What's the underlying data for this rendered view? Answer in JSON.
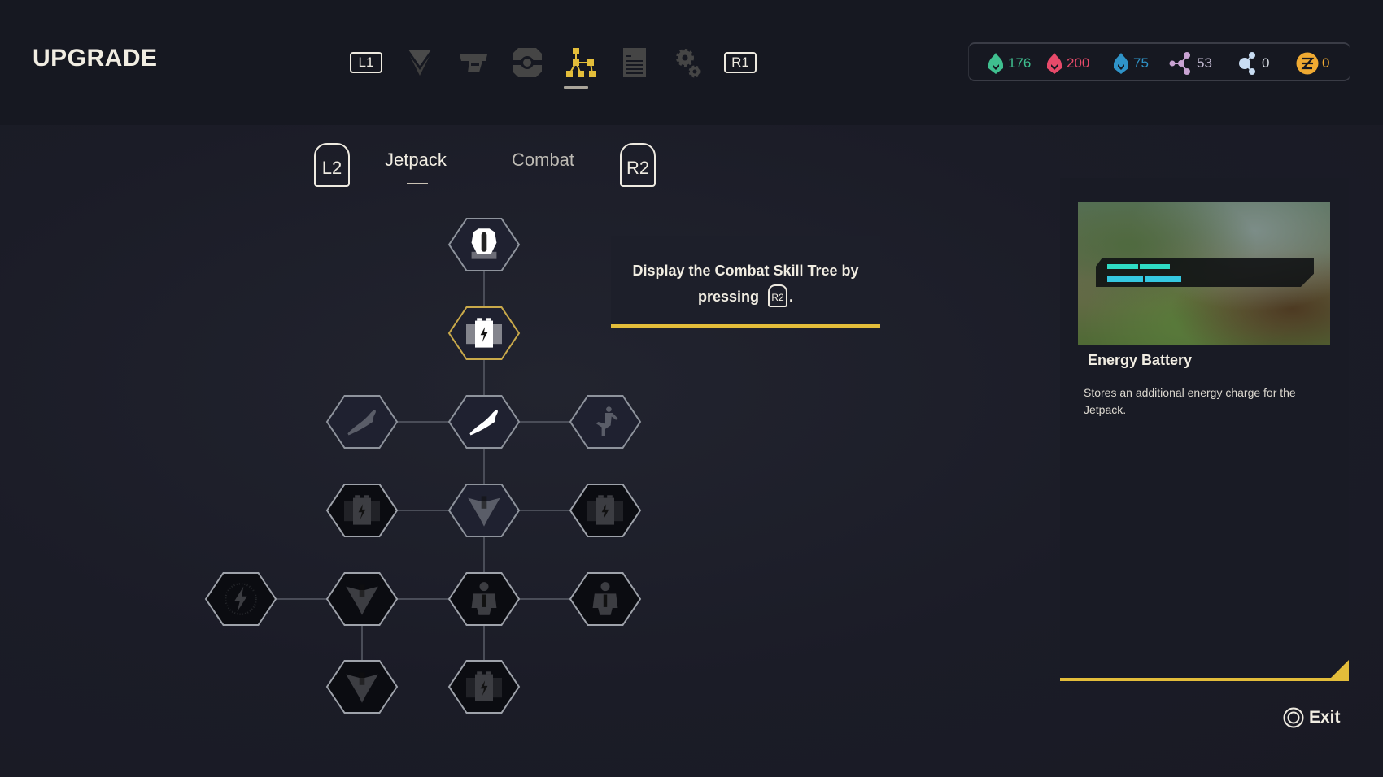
{
  "header": {
    "title": "UPGRADE",
    "nav": {
      "left_button": "L1",
      "right_button": "R1",
      "items": [
        {
          "icon": "chevron-emblem-icon",
          "active": false
        },
        {
          "icon": "weapon-icon",
          "active": false
        },
        {
          "icon": "gear-module-icon",
          "active": false
        },
        {
          "icon": "skill-tree-icon",
          "active": true
        },
        {
          "icon": "document-icon",
          "active": false
        },
        {
          "icon": "settings-gears-icon",
          "active": false
        }
      ]
    },
    "currencies": [
      {
        "icon": "green-flame-icon",
        "value": "176",
        "color": "#3fbf8f"
      },
      {
        "icon": "red-flame-icon",
        "value": "200",
        "color": "#e84a6a"
      },
      {
        "icon": "blue-flame-icon",
        "value": "75",
        "color": "#2f93c8"
      },
      {
        "icon": "purple-node-icon",
        "value": "53",
        "color": "#c9a3d3"
      },
      {
        "icon": "light-blue-node-icon",
        "value": "0",
        "color": "#c8dcf2"
      },
      {
        "icon": "z-coin-icon",
        "value": "0",
        "color": "#f0aa32"
      }
    ]
  },
  "tabs": {
    "left_trigger": "L2",
    "right_trigger": "R2",
    "items": [
      {
        "label": "Jetpack",
        "active": true
      },
      {
        "label": "Combat",
        "active": false
      }
    ]
  },
  "skill_tree": {
    "nodes": [
      {
        "id": "jetpack-core",
        "icon": "jetpack-icon",
        "state": "unlocked",
        "col": 2,
        "row": 0
      },
      {
        "id": "energy-battery",
        "icon": "battery-icon",
        "state": "selected",
        "col": 2,
        "row": 1
      },
      {
        "id": "glide",
        "icon": "glide-figure-icon",
        "state": "available",
        "col": 1,
        "row": 2
      },
      {
        "id": "flight",
        "icon": "flying-figure-icon",
        "state": "unlocked",
        "col": 2,
        "row": 2
      },
      {
        "id": "dash-kick",
        "icon": "kick-figure-icon",
        "state": "available",
        "col": 3,
        "row": 2
      },
      {
        "id": "battery-left",
        "icon": "battery-icon",
        "state": "locked",
        "col": 1,
        "row": 3
      },
      {
        "id": "wing-suit",
        "icon": "wingsuit-icon",
        "state": "available",
        "col": 2,
        "row": 3
      },
      {
        "id": "battery-right",
        "icon": "battery-icon",
        "state": "locked",
        "col": 3,
        "row": 3
      },
      {
        "id": "energy-burst",
        "icon": "lightning-icon",
        "state": "locked",
        "col": 0,
        "row": 4
      },
      {
        "id": "wing-suit-2",
        "icon": "wingsuit-icon",
        "state": "locked",
        "col": 1,
        "row": 4
      },
      {
        "id": "jetpack-armor",
        "icon": "jetpack-body-icon",
        "state": "locked",
        "col": 2,
        "row": 4
      },
      {
        "id": "jetpack-armor-2",
        "icon": "jetpack-body-icon",
        "state": "locked",
        "col": 3,
        "row": 4
      },
      {
        "id": "wing-suit-3",
        "icon": "wingsuit-icon",
        "state": "locked",
        "col": 1,
        "row": 5
      },
      {
        "id": "battery-bottom",
        "icon": "battery-icon",
        "state": "locked",
        "col": 2,
        "row": 5
      }
    ],
    "links": [
      [
        "jetpack-core",
        "energy-battery"
      ],
      [
        "energy-battery",
        "flight"
      ],
      [
        "glide",
        "flight"
      ],
      [
        "flight",
        "dash-kick"
      ],
      [
        "flight",
        "wing-suit"
      ],
      [
        "battery-left",
        "wing-suit"
      ],
      [
        "wing-suit",
        "battery-right"
      ],
      [
        "wing-suit",
        "jetpack-armor"
      ],
      [
        "energy-burst",
        "wing-suit-2"
      ],
      [
        "wing-suit-2",
        "jetpack-armor"
      ],
      [
        "jetpack-armor",
        "jetpack-armor-2"
      ],
      [
        "wing-suit-2",
        "wing-suit-3"
      ],
      [
        "jetpack-armor",
        "battery-bottom"
      ]
    ]
  },
  "hint": {
    "text_before": "Display the Combat Skill Tree by pressing",
    "button": "R2",
    "text_after": "."
  },
  "detail": {
    "title": "Energy Battery",
    "description": "Stores an additional energy charge for the Jetpack."
  },
  "footer": {
    "exit_label": "Exit"
  },
  "colors": {
    "accent": "#e3bd3a",
    "selected_border": "#c9a94a"
  }
}
